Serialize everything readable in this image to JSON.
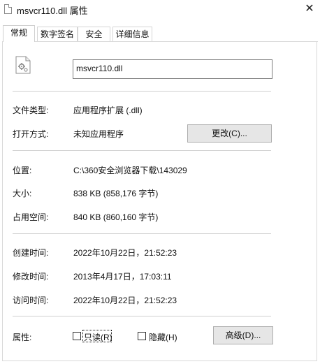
{
  "window": {
    "title": "msvcr110.dll 属性",
    "close_glyph": "✕"
  },
  "tabs": [
    {
      "label": "常规"
    },
    {
      "label": "数字签名"
    },
    {
      "label": "安全"
    },
    {
      "label": "详细信息"
    }
  ],
  "file": {
    "name": "msvcr110.dll"
  },
  "props": {
    "type_label": "文件类型:",
    "type_value": "应用程序扩展 (.dll)",
    "open_label": "打开方式:",
    "open_value": "未知应用程序",
    "change_button": "更改(C)...",
    "location_label": "位置:",
    "location_value": "C:\\360安全浏览器下载\\143029",
    "size_label": "大小:",
    "size_value": "838 KB (858,176 字节)",
    "disk_label": "占用空间:",
    "disk_value": "840 KB (860,160 字节)",
    "created_label": "创建时间:",
    "created_value": "2022年10月22日，21:52:23",
    "modified_label": "修改时间:",
    "modified_value": "2013年4月17日，17:03:11",
    "accessed_label": "访问时间:",
    "accessed_value": "2022年10月22日，21:52:23",
    "attr_label": "属性:",
    "readonly_label": "只读(R)",
    "hidden_label": "隐藏(H)",
    "advanced_button": "高级(D)..."
  },
  "icons": {
    "file": "dll-gear-file-icon",
    "close": "close-icon"
  }
}
